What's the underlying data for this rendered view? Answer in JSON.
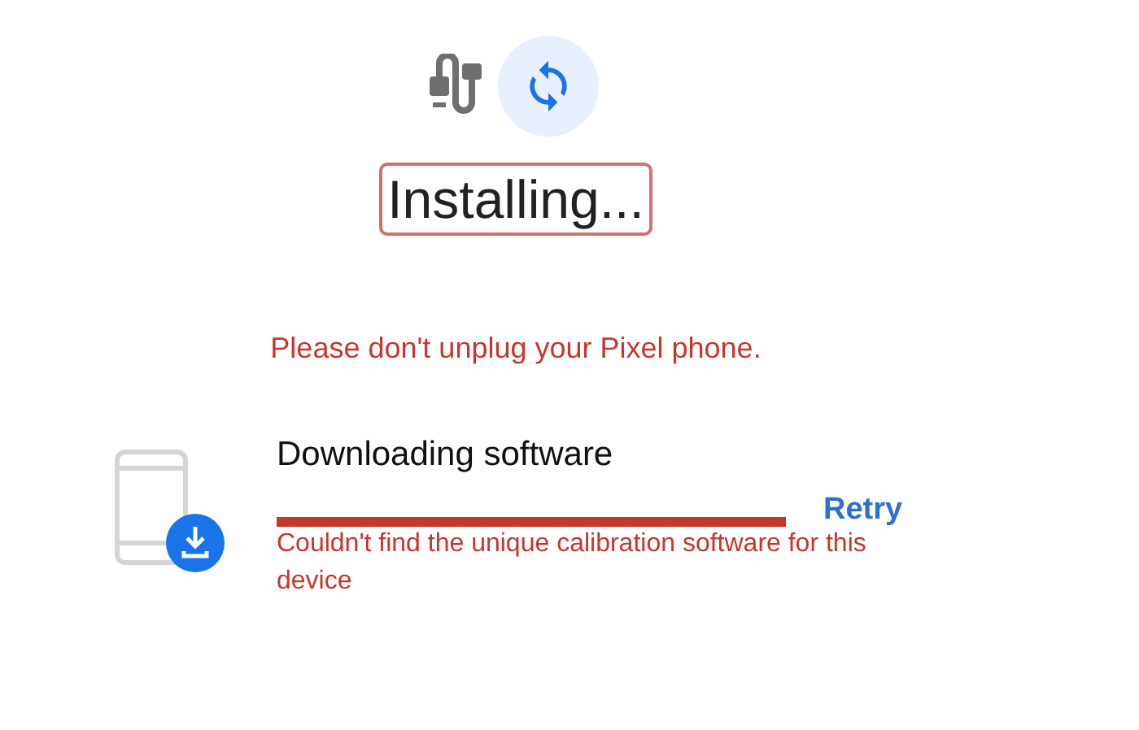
{
  "header": {
    "title": "Installing...",
    "title_highlighted": true
  },
  "warning": "Please don't unplug your Pixel phone.",
  "step": {
    "title": "Downloading software",
    "level": 1,
    "failed": true,
    "action": "Retry",
    "error": "Couldn't find the unique calibration software for this device"
  }
}
